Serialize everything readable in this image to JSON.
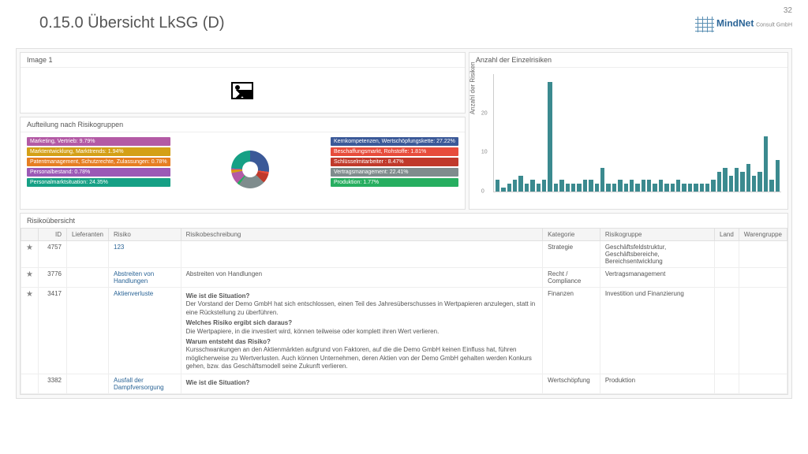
{
  "header": {
    "title": "0.15.0 Übersicht LkSG (D)",
    "page_number": "32",
    "logo_main": "MindNet",
    "logo_sub": "Consult GmbH"
  },
  "panels": {
    "image_title": "Image 1",
    "risk_groups_title": "Aufteilung nach Risikogruppen",
    "chart_title": "Anzahl der Einzelrisiken",
    "table_title": "Risikoübersicht"
  },
  "risk_groups_left": [
    {
      "label": "Marketing, Vertrieb: 9.79%",
      "color": "#b35aa5"
    },
    {
      "label": "Marktentwicklung, Markttrends: 1.94%",
      "color": "#d4a017"
    },
    {
      "label": "Patentmanagement, Schutzrechte, Zulassungen: 0.78%",
      "color": "#e67e22"
    },
    {
      "label": "Personalbestand: 0.78%",
      "color": "#9b59b6"
    },
    {
      "label": "Personalmarktsituation: 24.35%",
      "color": "#16a085"
    }
  ],
  "risk_groups_right": [
    {
      "label": "Kernkompetenzen, Wertschöpfungskette: 27.22%",
      "color": "#3b5998"
    },
    {
      "label": "Beschaffungsmarkt, Rohstoffe: 1.81%",
      "color": "#e74c3c"
    },
    {
      "label": "Schlüsselmitarbeiter : 8.47%",
      "color": "#c0392b"
    },
    {
      "label": "Vertragsmanagement: 22.41%",
      "color": "#7f8c8d"
    },
    {
      "label": "Produktion: 1.77%",
      "color": "#27ae60"
    }
  ],
  "chart_data": {
    "type": "bar",
    "ylabel": "Anzahl der Risiken",
    "ylim": [
      0,
      30
    ],
    "yticks": [
      0,
      10,
      20
    ],
    "values": [
      3,
      1,
      2,
      3,
      4,
      2,
      3,
      2,
      3,
      28,
      2,
      3,
      2,
      2,
      2,
      3,
      3,
      2,
      6,
      2,
      2,
      3,
      2,
      3,
      2,
      3,
      3,
      2,
      3,
      2,
      2,
      3,
      2,
      2,
      2,
      2,
      2,
      3,
      5,
      6,
      4,
      6,
      5,
      7,
      4,
      5,
      14,
      3,
      8
    ]
  },
  "table": {
    "columns": [
      "",
      "ID",
      "Lieferanten",
      "Risiko",
      "Risikobeschreibung",
      "Kategorie",
      "Risikogruppe",
      "Land",
      "Warengruppe"
    ],
    "rows": [
      {
        "star": true,
        "id": "4757",
        "lieferanten": "",
        "risiko": "123",
        "beschreibung": "",
        "kategorie": "Strategie",
        "gruppe": "Geschäftsfeldstruktur, Geschäftsbereiche, Bereichsentwicklung",
        "land": "",
        "warengruppe": ""
      },
      {
        "star": true,
        "id": "3776",
        "lieferanten": "",
        "risiko": "Abstreiten von Handlungen",
        "beschreibung": "Abstreiten von Handlungen",
        "kategorie": "Recht / Compliance",
        "gruppe": "Vertragsmanagement",
        "land": "",
        "warengruppe": ""
      },
      {
        "star": true,
        "id": "3417",
        "lieferanten": "",
        "risiko": "Aktienverluste",
        "beschreibung_rich": {
          "q1": "Wie ist die Situation?",
          "a1": "Der Vorstand der Demo GmbH hat sich entschlossen, einen Teil des Jahresüberschusses in Wertpapieren anzulegen, statt in eine Rückstellung zu überführen.",
          "q2": "Welches Risiko ergibt sich daraus?",
          "a2": "Die Wertpapiere, in die investiert wird, können teilweise oder komplett ihren Wert verlieren.",
          "q3": "Warum entsteht das Risiko?",
          "a3": "Kursschwankungen an den Aktienmärkten aufgrund von Faktoren, auf die die Demo GmbH keinen Einfluss hat, führen möglicherweise zu Wertverlusten. Auch können Unternehmen, deren Aktien von der Demo GmbH gehalten werden Konkurs gehen, bzw. das Geschäftsmodell seine Zukunft verlieren."
        },
        "kategorie": "Finanzen",
        "gruppe": "Investition und Finanzierung",
        "land": "",
        "warengruppe": ""
      },
      {
        "star": false,
        "id": "3382",
        "lieferanten": "",
        "risiko": "Ausfall der Dampfversorgung",
        "beschreibung_rich": {
          "q1": "Wie ist die Situation?"
        },
        "kategorie": "Wertschöpfung",
        "gruppe": "Produktion",
        "land": "",
        "warengruppe": ""
      }
    ]
  }
}
